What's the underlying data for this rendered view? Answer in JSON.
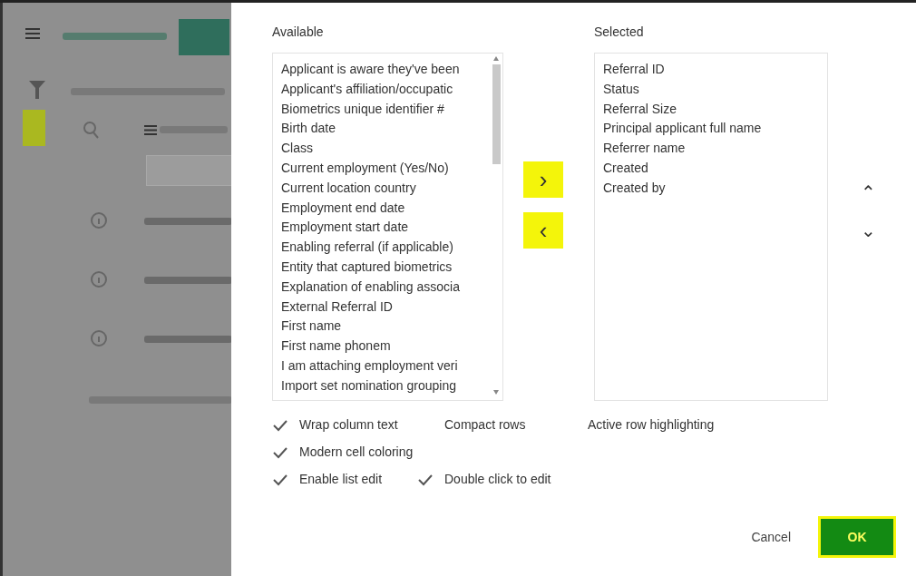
{
  "available": {
    "label": "Available",
    "items": [
      "Applicant is aware they've been",
      "Applicant's affiliation/occupatic",
      "Biometrics unique identifier #",
      "Birth date",
      "Class",
      "Current employment (Yes/No)",
      "Current location country",
      "Employment end date",
      "Employment start date",
      "Enabling referral (if applicable)",
      "Entity that captured biometrics",
      "Explanation of enabling associa",
      "External Referral ID",
      "First name",
      "First name phonem",
      "I am attaching employment veri",
      "Import set nomination grouping"
    ]
  },
  "transfer_buttons": [
    {
      "text": "›",
      "highlighted": true
    },
    {
      "text": "‹",
      "highlighted": true
    }
  ],
  "selected": {
    "label": "Selected",
    "items": [
      "Referral ID",
      "Status",
      "Referral Size",
      "Principal applicant full name",
      "Referrer name",
      "Created",
      "Created by"
    ]
  },
  "order_buttons": [
    {
      "text": "⌃",
      "highlighted": false
    },
    {
      "text": "⌄",
      "highlighted": false
    }
  ],
  "options": [
    [
      {
        "label": "Wrap column text",
        "checked": true
      },
      {
        "label": "Compact rows",
        "checked": false
      },
      {
        "label": "Active row highlighting",
        "checked": false
      }
    ],
    [
      {
        "label": "Modern cell coloring",
        "checked": true
      }
    ],
    [
      {
        "label": "Enable list edit",
        "checked": true
      },
      {
        "label": "Double click to edit",
        "checked": true
      }
    ]
  ],
  "footer": {
    "cancel": "Cancel",
    "ok": {
      "text": "OK",
      "highlighted": true
    }
  },
  "background": {
    "sidebar_icon_highlighted": true
  }
}
